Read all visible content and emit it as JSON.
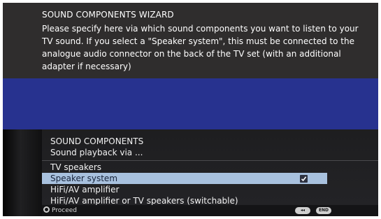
{
  "wizard": {
    "title": "SOUND COMPONENTS WIZARD",
    "description": "Please specify here via which sound components you want to listen to your TV sound. If you select a \"Speaker system\", this must be connected to the analogue audio connector on the back of the TV set (with an additional adapter if necessary)"
  },
  "panel": {
    "title": "SOUND COMPONENTS",
    "subtitle": "Sound playback via ...",
    "options": [
      {
        "label": "TV speakers",
        "selected": false
      },
      {
        "label": "Speaker system",
        "selected": true,
        "checked": true
      },
      {
        "label": "HiFi/AV amplifier",
        "selected": false
      },
      {
        "label": "HiFi/AV amplifier or TV speakers (switchable)",
        "selected": false
      }
    ]
  },
  "footer": {
    "proceed_label": "Proceed",
    "back_button_label": "◂◂",
    "end_button_label": "END"
  },
  "colors": {
    "background": "#2d2b2b",
    "blue_band": "#27328f",
    "selection": "#a8c1de",
    "text": "#ffffff"
  }
}
